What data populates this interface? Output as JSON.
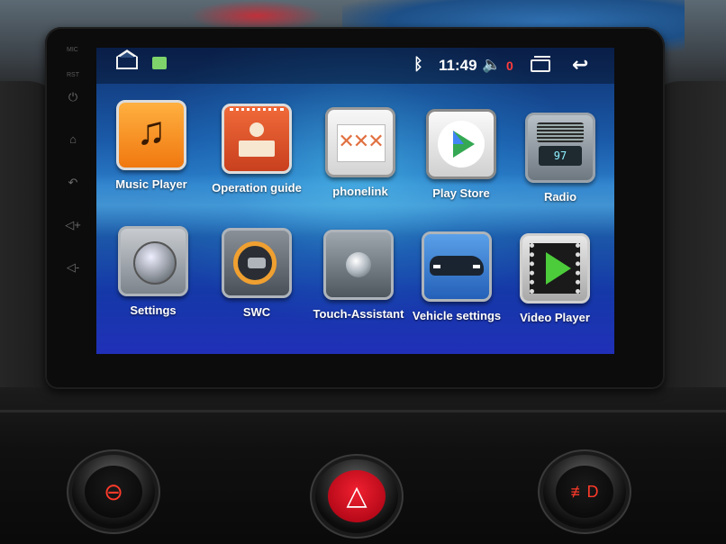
{
  "status_bar": {
    "bluetooth_icon": "bluetooth-icon",
    "time": "11:49",
    "volume_icon": "volume-icon",
    "volume_level": "0"
  },
  "apps": [
    {
      "label": "Music Player",
      "icon": "music-icon"
    },
    {
      "label": "Operation guide",
      "icon": "guide-icon"
    },
    {
      "label": "phonelink",
      "icon": "phonelink-icon"
    },
    {
      "label": "Play Store",
      "icon": "play-store-icon"
    },
    {
      "label": "Radio",
      "icon": "radio-icon"
    },
    {
      "label": "Settings",
      "icon": "settings-icon"
    },
    {
      "label": "SWC",
      "icon": "steering-wheel-icon"
    },
    {
      "label": "Touch-Assistant",
      "icon": "touch-assistant-icon"
    },
    {
      "label": "Vehicle settings",
      "icon": "car-icon"
    },
    {
      "label": "Video Player",
      "icon": "video-icon"
    }
  ],
  "side_keys": {
    "mic_label": "MIC",
    "rst_label": "RST",
    "vol_up": "◁+",
    "vol_down": "◁-"
  },
  "radio_display": "97",
  "colors": {
    "accent_volume": "#ff3b3b",
    "hazard": "#f02030"
  }
}
